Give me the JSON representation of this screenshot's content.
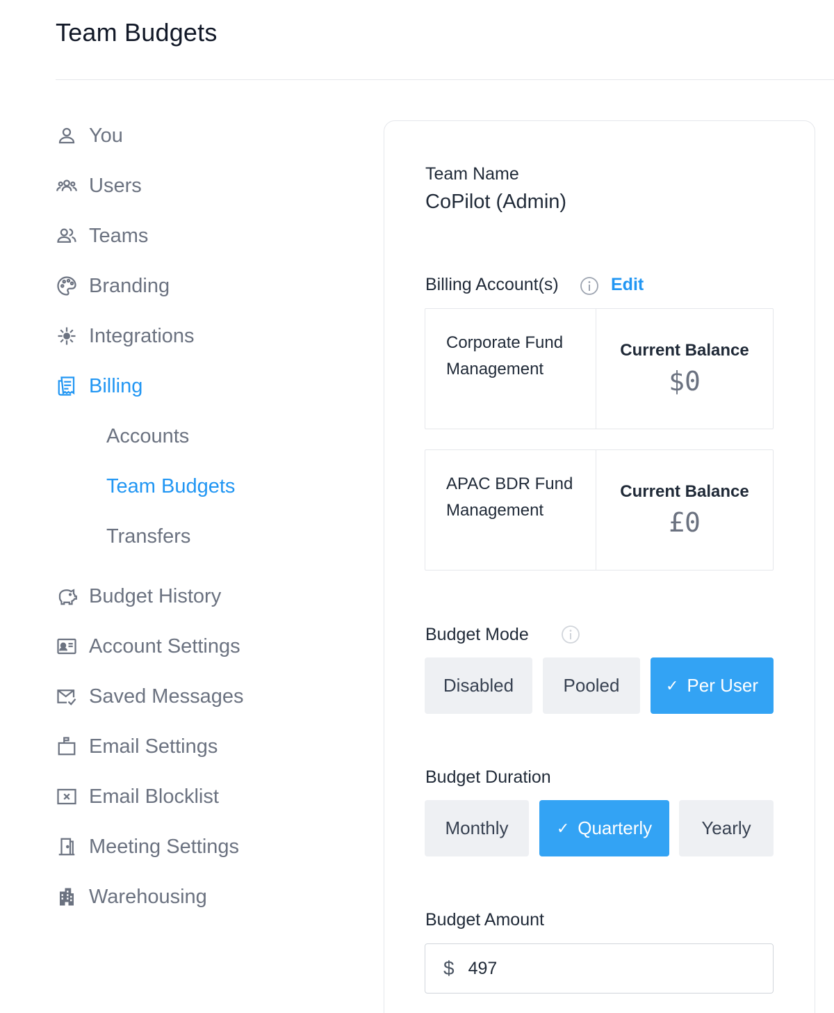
{
  "page": {
    "title": "Team Budgets"
  },
  "sidebar": {
    "items": [
      {
        "label": "You",
        "icon": "user-icon"
      },
      {
        "label": "Users",
        "icon": "users-group-icon"
      },
      {
        "label": "Teams",
        "icon": "team-icon"
      },
      {
        "label": "Branding",
        "icon": "palette-icon"
      },
      {
        "label": "Integrations",
        "icon": "integrations-icon"
      },
      {
        "label": "Billing",
        "icon": "receipt-icon",
        "active": true
      }
    ],
    "billing_sub": [
      {
        "label": "Accounts"
      },
      {
        "label": "Team Budgets",
        "active": true
      },
      {
        "label": "Transfers"
      }
    ],
    "items2": [
      {
        "label": "Budget History",
        "icon": "piggy-bank-icon"
      },
      {
        "label": "Account Settings",
        "icon": "id-card-icon"
      },
      {
        "label": "Saved Messages",
        "icon": "mail-check-icon"
      },
      {
        "label": "Email Settings",
        "icon": "mailbox-icon"
      },
      {
        "label": "Email Blocklist",
        "icon": "blocklist-icon"
      },
      {
        "label": "Meeting Settings",
        "icon": "door-icon"
      },
      {
        "label": "Warehousing",
        "icon": "building-icon"
      }
    ]
  },
  "team": {
    "name_label": "Team Name",
    "name_value": "CoPilot (Admin)"
  },
  "billing": {
    "label": "Billing Account(s)",
    "edit_label": "Edit",
    "accounts": [
      {
        "name": "Corporate Fund Management",
        "balance_label": "Current Balance",
        "balance": "$0"
      },
      {
        "name": "APAC BDR Fund Management",
        "balance_label": "Current Balance",
        "balance": "£0"
      }
    ]
  },
  "budget_mode": {
    "label": "Budget Mode",
    "options": [
      "Disabled",
      "Pooled",
      "Per User"
    ],
    "selected": "Per User"
  },
  "budget_duration": {
    "label": "Budget Duration",
    "options": [
      "Monthly",
      "Quarterly",
      "Yearly"
    ],
    "selected": "Quarterly"
  },
  "budget_amount": {
    "label": "Budget Amount",
    "currency": "$",
    "value": "497"
  },
  "colors": {
    "accent": "#2196f3",
    "selected_bg": "#33a3f4",
    "muted": "#6b7280"
  }
}
